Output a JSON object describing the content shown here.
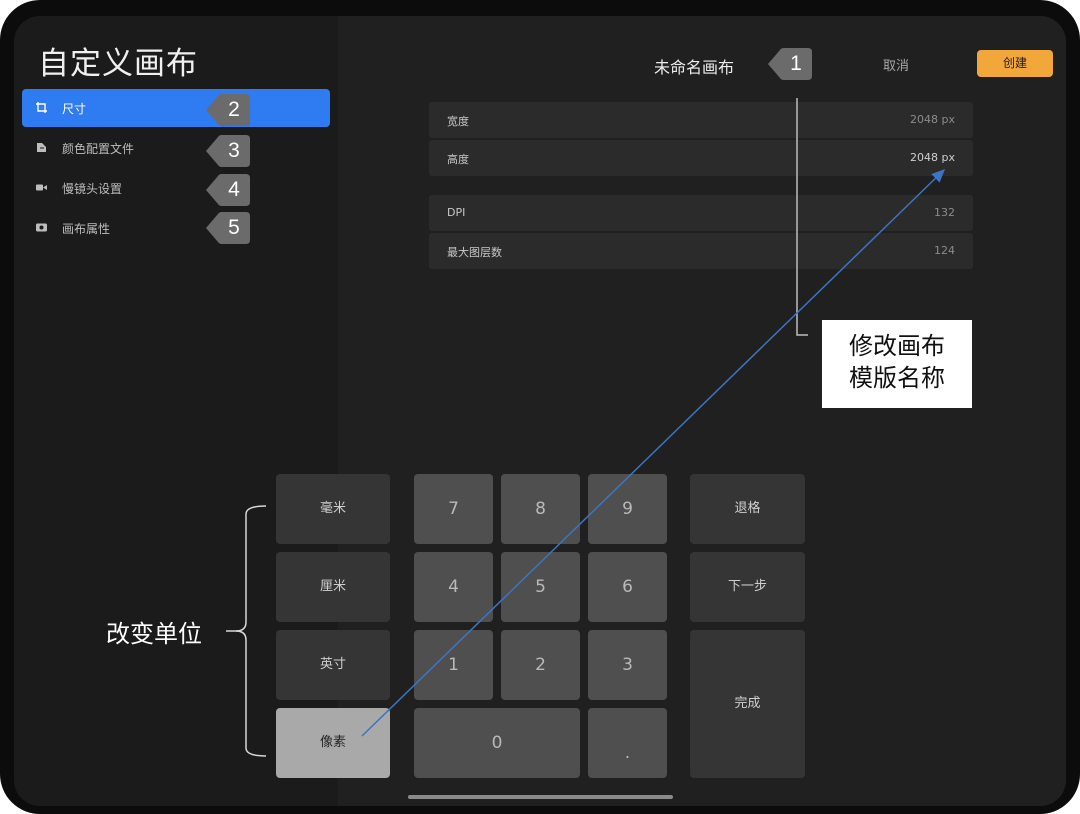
{
  "sidebar": {
    "title": "自定义画布",
    "items": [
      {
        "label": "尺寸",
        "icon": "crop-icon"
      },
      {
        "label": "颜色配置文件",
        "icon": "color-profile-icon"
      },
      {
        "label": "慢镜头设置",
        "icon": "video-camera-icon"
      },
      {
        "label": "画布属性",
        "icon": "canvas-properties-icon"
      }
    ],
    "active_index": 0
  },
  "header": {
    "canvas_name": "未命名画布",
    "cancel_label": "取消",
    "create_label": "创建"
  },
  "fields": [
    {
      "label": "宽度",
      "value": "2048 px"
    },
    {
      "label": "高度",
      "value": "2048 px"
    },
    {
      "label": "DPI",
      "value": "132"
    },
    {
      "label": "最大图层数",
      "value": "124"
    }
  ],
  "keypad": {
    "units": [
      "毫米",
      "厘米",
      "英寸",
      "像素"
    ],
    "selected_unit": "像素",
    "digits": [
      "7",
      "8",
      "9",
      "4",
      "5",
      "6",
      "1",
      "2",
      "3",
      "0",
      "."
    ],
    "backspace_label": "退格",
    "next_label": "下一步",
    "done_label": "完成"
  },
  "annotations": {
    "badges": [
      "1",
      "2",
      "3",
      "4",
      "5"
    ],
    "callout_line1": "修改画布",
    "callout_line2": "模版名称",
    "units_label": "改变单位"
  },
  "colors": {
    "accent_blue": "#2f7bf1",
    "create_orange": "#f2a73b",
    "badge_gray": "#6b6b6b",
    "arrow_blue": "#3e74c4"
  }
}
